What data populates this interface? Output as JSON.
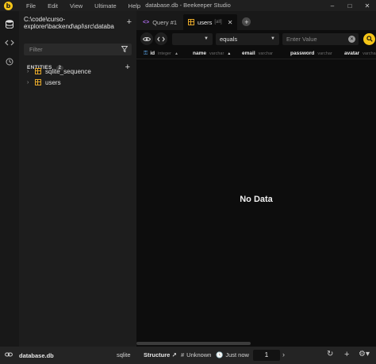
{
  "window": {
    "title": "database.db - Beekeeper Studio",
    "logo_letter": "b",
    "controls": [
      "–",
      "□",
      "✕"
    ]
  },
  "menu": [
    "File",
    "Edit",
    "View",
    "Ultimate",
    "Help"
  ],
  "sidebar": {
    "connection_path": [
      "C:\\code\\curso-",
      "explorer\\backend\\api\\src\\databa"
    ],
    "filter_placeholder": "Filter",
    "entities_label": "ENTITIES",
    "entities_count": "2",
    "items": [
      {
        "label": "sqlite_sequence"
      },
      {
        "label": "users"
      }
    ]
  },
  "tabs": [
    {
      "code": "<>",
      "label": "Query #1",
      "active": false
    },
    {
      "label": "users",
      "sub": "[all]",
      "active": true
    }
  ],
  "filterbar": {
    "column_value": "",
    "operator_value": "equals",
    "value_placeholder": "Enter Value"
  },
  "columns": [
    {
      "name": "id",
      "type": "integer",
      "primary": true
    },
    {
      "name": "name",
      "type": "varchar"
    },
    {
      "name": "email",
      "type": "varchar"
    },
    {
      "name": "password",
      "type": "varchar"
    },
    {
      "name": "avatar",
      "type": "varchar"
    }
  ],
  "empty_message": "No Data",
  "statusbar": {
    "database": "database.db",
    "db_type": "sqlite",
    "structure_label": "Structure",
    "structure_arrow": "↗",
    "row_count": "Unknown",
    "updated": "Just now",
    "page": "1"
  },
  "colors": {
    "accent": "#f5c518",
    "table_icon": "#e4a72a",
    "query_icon": "#b26df2",
    "key_icon": "#5aa4e8"
  }
}
